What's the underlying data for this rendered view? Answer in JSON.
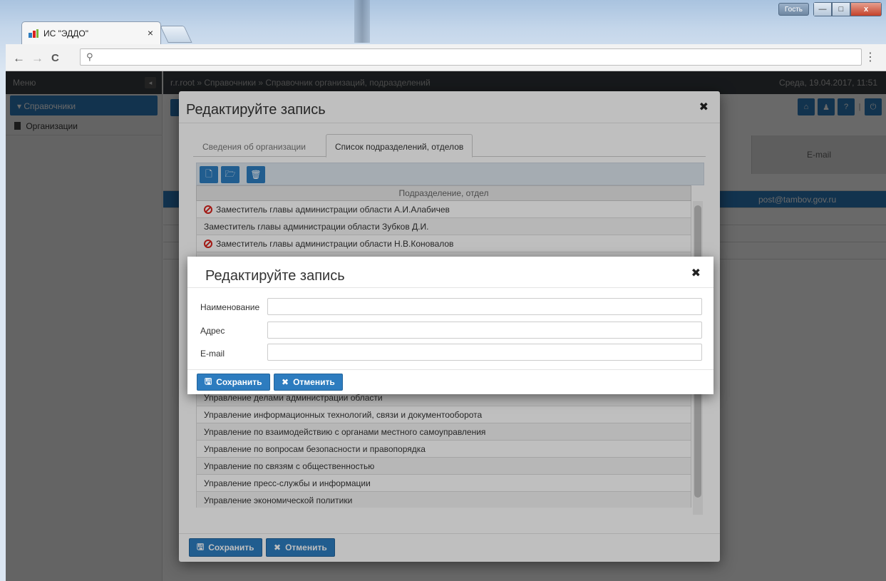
{
  "browser": {
    "tab_title": "ИС \"ЭДДО\"",
    "guest_label": "Гость",
    "close_symbol": "×",
    "window_close_symbol": "x",
    "minimize_symbol": "—",
    "maximize_symbol": "□",
    "back_symbol": "←",
    "forward_symbol": "→",
    "reload_symbol": "C",
    "search_symbol": "⚲",
    "menu_symbol": "⋮"
  },
  "app": {
    "menu_label": "Меню",
    "collapse_symbol": "◂",
    "sidebar_section": "▾  Справочники",
    "sidebar_item": "Организации",
    "breadcrumb": "r.r.root  »  Справочники  »  Справочник организаций, подразделений",
    "datetime": "Среда, 19.04.2017, 11:51",
    "column_email": "E-mail",
    "row_email": "post@tambov.gov.ru",
    "top_icon_home": "⌂",
    "top_icon_user": "♟",
    "top_icon_help": "?",
    "top_icon_power": "⏻"
  },
  "outer_modal": {
    "title": "Редактируйте запись",
    "close_symbol": "✖",
    "tabs": [
      "Сведения об организации",
      "Список подразделений, отделов"
    ],
    "toolbar_icons": [
      "new-file-icon",
      "open-folder-icon",
      "trash-icon"
    ],
    "toolbar_glyphs": [
      "🗋",
      "🗁",
      "🗑"
    ],
    "column_header": "Подразделение, отдел",
    "rows": [
      {
        "text": "Заместитель главы администрации области А.И.Алабичев",
        "banned": true
      },
      {
        "text": "Заместитель главы администрации области Зубков Д.И.",
        "banned": false
      },
      {
        "text": "Заместитель главы администрации области Н.В.Коновалов",
        "banned": true
      },
      {
        "text": "",
        "banned": false
      },
      {
        "text": "",
        "banned": false
      },
      {
        "text": "",
        "banned": false
      },
      {
        "text": "",
        "banned": false
      },
      {
        "text": "",
        "banned": false
      },
      {
        "text": "",
        "banned": false
      },
      {
        "text": "",
        "banned": false
      },
      {
        "text": "",
        "banned": false
      },
      {
        "text": "Управление делами администрации области",
        "banned": false
      },
      {
        "text": "Управление информационных технологий, связи и документооборота",
        "banned": false
      },
      {
        "text": "Управление по взаимодействию с органами местного самоуправления",
        "banned": false
      },
      {
        "text": "Управление по вопросам безопасности и правопорядка",
        "banned": false
      },
      {
        "text": "Управление по связям с общественностью",
        "banned": false
      },
      {
        "text": "Управление пресс-службы и информации",
        "banned": false
      },
      {
        "text": "Управление экономической политики",
        "banned": false
      }
    ],
    "save_label": "Сохранить",
    "cancel_label": "Отменить",
    "save_glyph": "🖫",
    "cancel_glyph": "✖"
  },
  "inner_modal": {
    "title": "Редактируйте запись",
    "close_symbol": "✖",
    "fields": {
      "name_label": "Наименование",
      "name_value": "",
      "address_label": "Адрес",
      "address_value": "",
      "email_label": "E-mail",
      "email_value": ""
    },
    "save_label": "Сохранить",
    "cancel_label": "Отменить",
    "save_glyph": "🖫",
    "cancel_glyph": "✖"
  }
}
